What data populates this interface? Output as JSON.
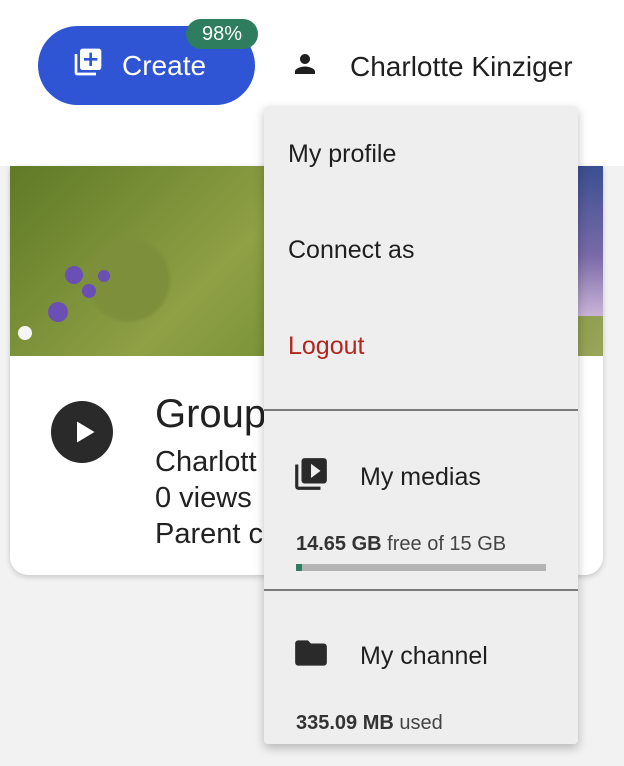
{
  "header": {
    "create_label": "Create",
    "badge": "98%",
    "user_name": "Charlotte Kinziger"
  },
  "card": {
    "title": "Group",
    "author": "Charlott",
    "views": "0 views",
    "parent": "Parent c"
  },
  "menu": {
    "items": [
      "My profile",
      "Connect as",
      "Logout"
    ],
    "medias": {
      "label": "My medias",
      "used_value": "14.65 GB",
      "used_suffix": "free of 15 GB",
      "used_fraction": 0.023
    },
    "channel": {
      "label": "My channel",
      "used_value": "335.09 MB",
      "used_suffix": "used"
    }
  },
  "colors": {
    "primary": "#2f55d4",
    "badge": "#2e7d5f",
    "logout": "#b3261e"
  }
}
